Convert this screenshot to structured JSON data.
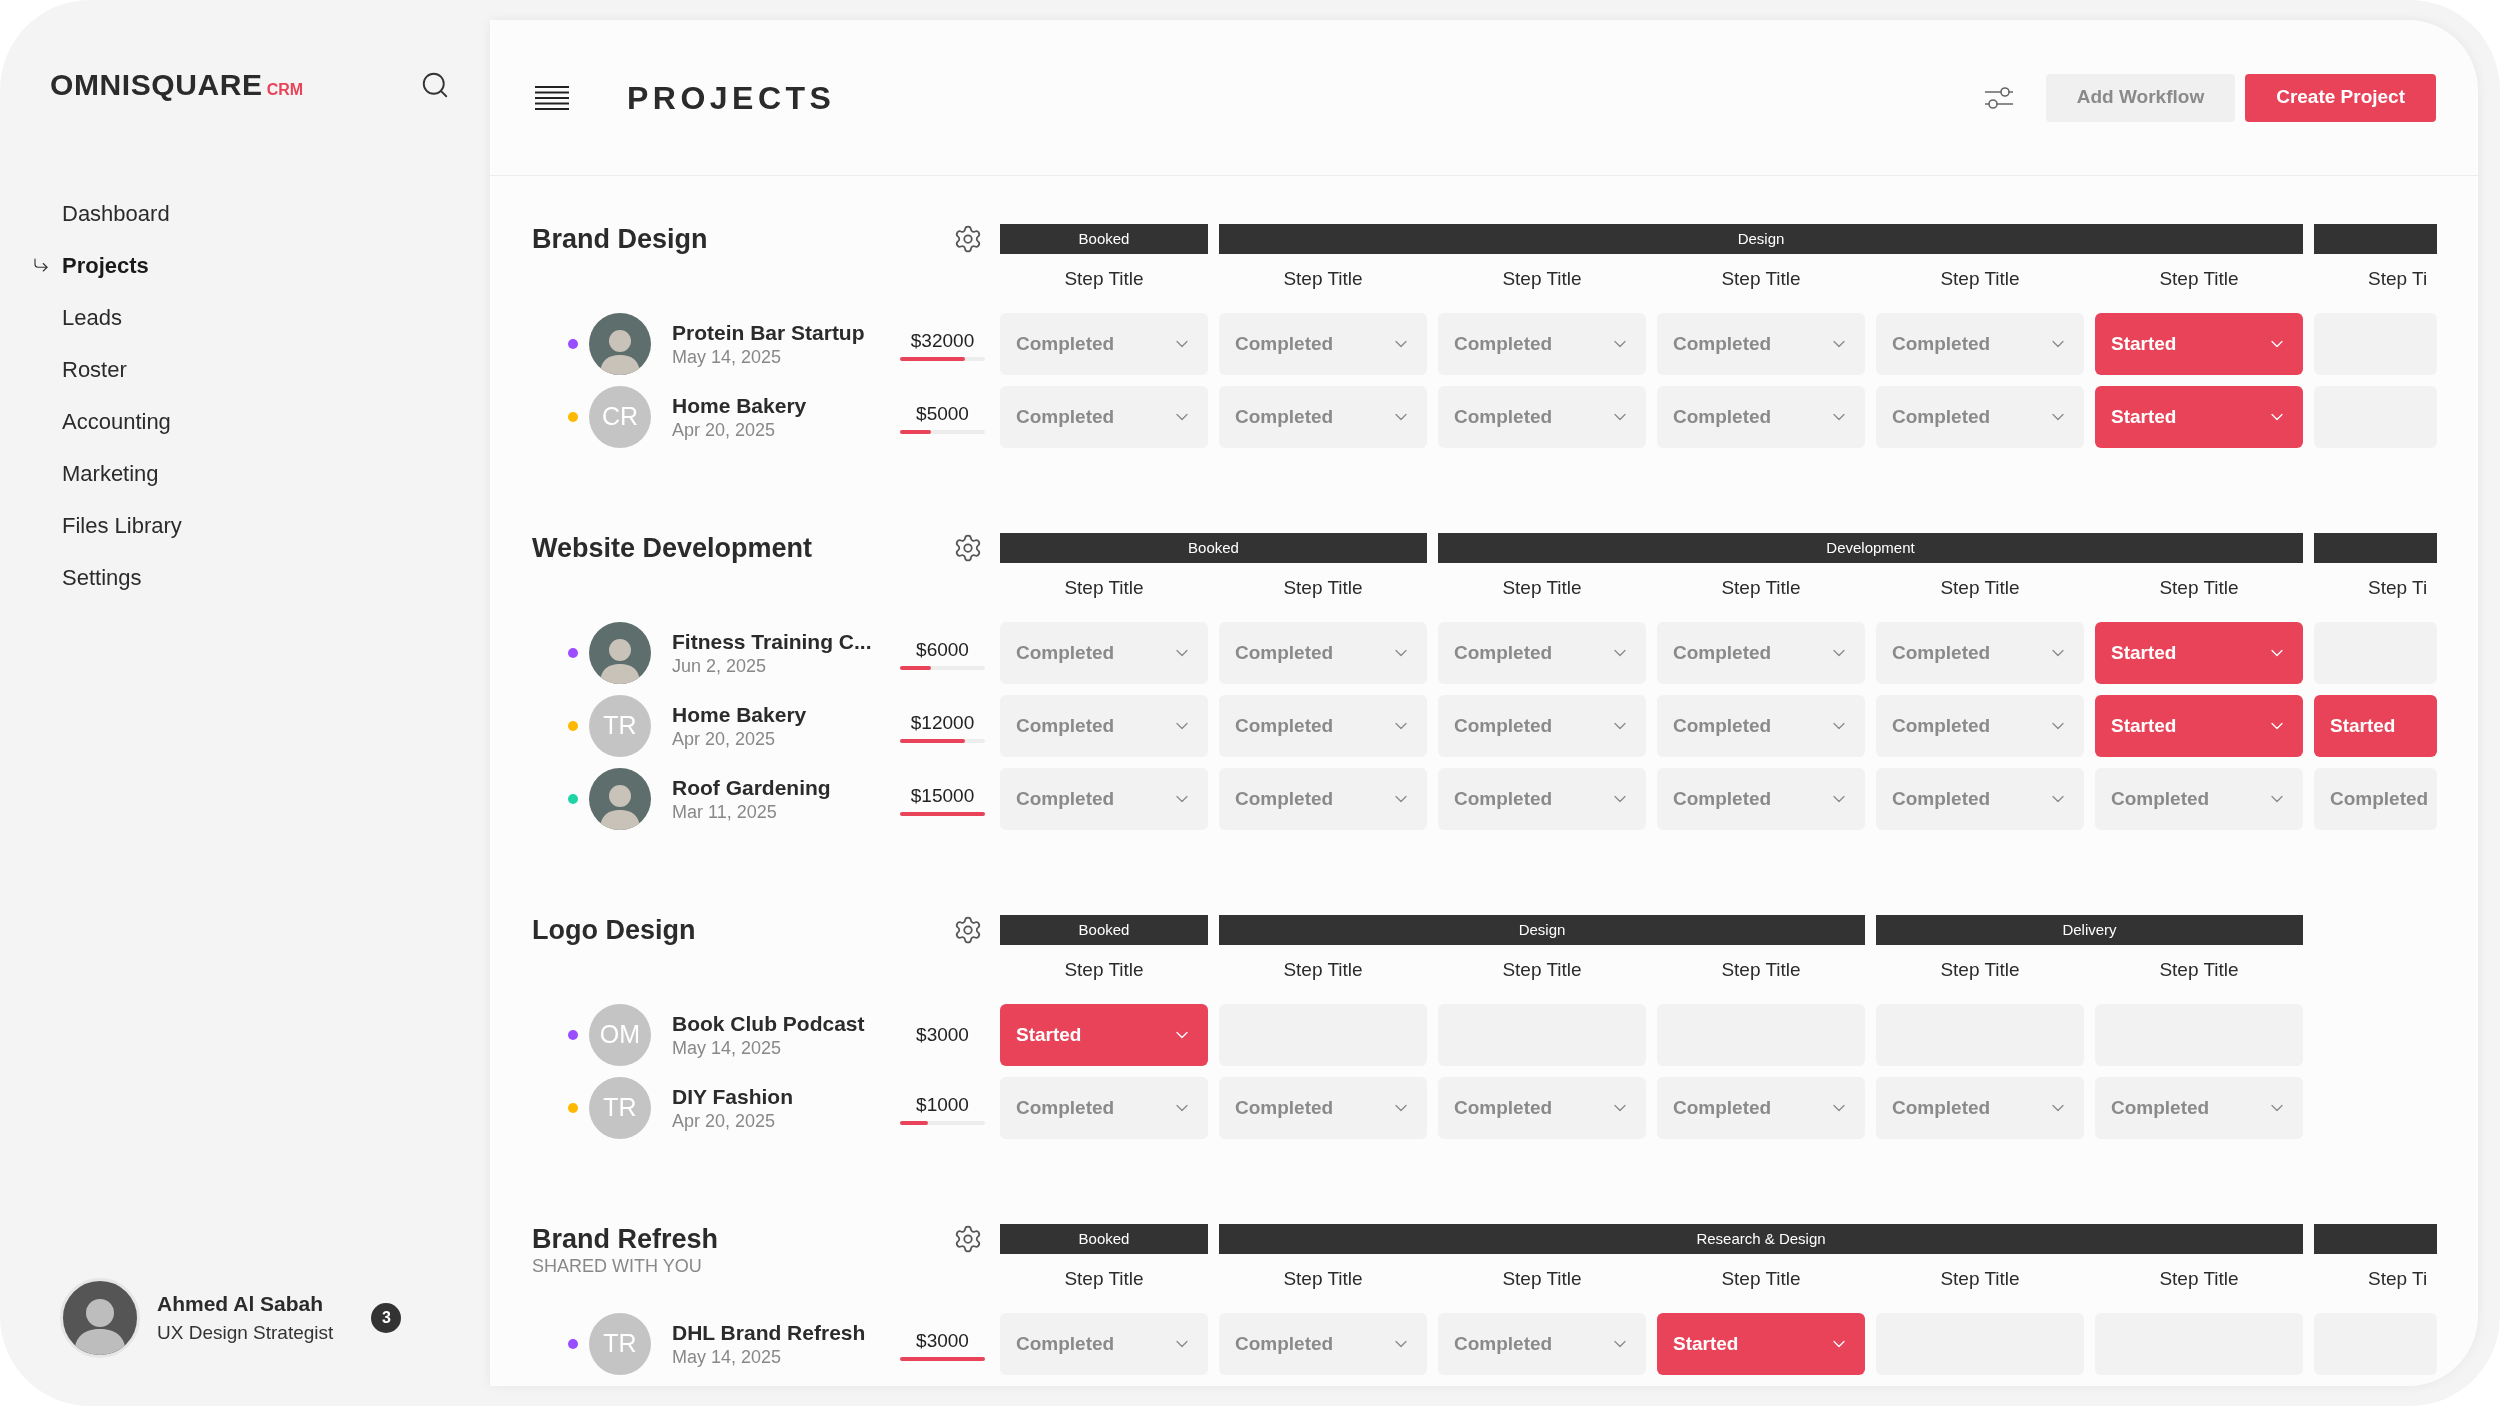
{
  "sidebar": {
    "logo": {
      "name": "OMNISQUARE",
      "suffix": "CRM"
    },
    "items": [
      {
        "label": "Dashboard",
        "selected": false
      },
      {
        "label": "Projects",
        "selected": true
      },
      {
        "label": "Leads",
        "selected": false
      },
      {
        "label": "Roster",
        "selected": false
      },
      {
        "label": "Accounting",
        "selected": false
      },
      {
        "label": "Marketing",
        "selected": false
      },
      {
        "label": "Files Library",
        "selected": false
      },
      {
        "label": "Settings",
        "selected": false
      }
    ],
    "user": {
      "name": "Ahmed Al Sabah",
      "role": "UX Design Strategist",
      "badge": "3"
    }
  },
  "header": {
    "title": "PROJECTS",
    "buttons": [
      {
        "label": "Add Workflow",
        "kind": "secondary"
      },
      {
        "label": "Create Project",
        "kind": "primary"
      }
    ]
  },
  "sections": [
    {
      "title": "Brand Design",
      "groups": [
        {
          "label": "Booked",
          "steps": [
            {
              "title": "Step Title",
              "cut": false
            }
          ]
        },
        {
          "label": "Design",
          "steps": [
            {
              "title": "Step Title",
              "cut": false
            },
            {
              "title": "Step Title",
              "cut": false
            },
            {
              "title": "Step Title",
              "cut": false
            },
            {
              "title": "Step Title",
              "cut": false
            },
            {
              "title": "Step Title",
              "cut": false
            }
          ]
        },
        {
          "steps": [
            {
              "title": "Step Ti",
              "cut": true
            }
          ]
        }
      ],
      "rows": [
        {
          "name": "Protein Bar Startup",
          "date": "May 14, 2025",
          "color": "#9b4dff",
          "avatar": {
            "kind": "photo"
          },
          "price": "$32000",
          "level": 0.77,
          "cells": [
            {
              "kind": "done",
              "label": "Completed"
            },
            {
              "kind": "done",
              "label": "Completed"
            },
            {
              "kind": "done",
              "label": "Completed"
            },
            {
              "kind": "done",
              "label": "Completed"
            },
            {
              "kind": "done",
              "label": "Completed"
            },
            {
              "kind": "active",
              "label": "Started"
            },
            {
              "kind": "empty"
            }
          ]
        },
        {
          "name": "Home Bakery",
          "date": "Apr 20, 2025",
          "color": "#ffb800",
          "avatar": {
            "kind": "initials",
            "text": "CR"
          },
          "price": "$5000",
          "level": 0.37,
          "cells": [
            {
              "kind": "done",
              "label": "Completed"
            },
            {
              "kind": "done",
              "label": "Completed"
            },
            {
              "kind": "done",
              "label": "Completed"
            },
            {
              "kind": "done",
              "label": "Completed"
            },
            {
              "kind": "done",
              "label": "Completed"
            },
            {
              "kind": "active",
              "label": "Started"
            },
            {
              "kind": "empty"
            }
          ]
        }
      ]
    },
    {
      "title": "Website Development",
      "groups": [
        {
          "label": "Booked",
          "steps": [
            {
              "title": "Step Title",
              "cut": false
            },
            {
              "title": "Step Title",
              "cut": false
            }
          ]
        },
        {
          "label": "Development",
          "steps": [
            {
              "title": "Step Title",
              "cut": false
            },
            {
              "title": "Step Title",
              "cut": false
            },
            {
              "title": "Step Title",
              "cut": false
            },
            {
              "title": "Step Title",
              "cut": false
            }
          ]
        },
        {
          "steps": [
            {
              "title": "Step Ti",
              "cut": true
            }
          ]
        }
      ],
      "rows": [
        {
          "name": "Fitness Training C...",
          "date": "Jun 2, 2025",
          "color": "#9b4dff",
          "avatar": {
            "kind": "photo"
          },
          "price": "$6000",
          "level": 0.37,
          "cells": [
            {
              "kind": "done",
              "label": "Completed"
            },
            {
              "kind": "done",
              "label": "Completed"
            },
            {
              "kind": "done",
              "label": "Completed"
            },
            {
              "kind": "done",
              "label": "Completed"
            },
            {
              "kind": "done",
              "label": "Completed"
            },
            {
              "kind": "active",
              "label": "Started"
            },
            {
              "kind": "empty"
            }
          ]
        },
        {
          "name": "Home Bakery",
          "date": "Apr 20, 2025",
          "color": "#ffb800",
          "avatar": {
            "kind": "initials",
            "text": "TR"
          },
          "price": "$12000",
          "level": 0.77,
          "cells": [
            {
              "kind": "done",
              "label": "Completed"
            },
            {
              "kind": "done",
              "label": "Completed"
            },
            {
              "kind": "done",
              "label": "Completed"
            },
            {
              "kind": "done",
              "label": "Completed"
            },
            {
              "kind": "done",
              "label": "Completed"
            },
            {
              "kind": "active",
              "label": "Started"
            },
            {
              "kind": "active",
              "label": "Started"
            }
          ]
        },
        {
          "name": "Roof Gardening",
          "date": "Mar 11, 2025",
          "color": "#1ed4a6",
          "avatar": {
            "kind": "photo"
          },
          "price": "$15000",
          "level": 1,
          "cells": [
            {
              "kind": "done",
              "label": "Completed"
            },
            {
              "kind": "done",
              "label": "Completed"
            },
            {
              "kind": "done",
              "label": "Completed"
            },
            {
              "kind": "done",
              "label": "Completed"
            },
            {
              "kind": "done",
              "label": "Completed"
            },
            {
              "kind": "done",
              "label": "Completed"
            },
            {
              "kind": "done",
              "label": "Completed"
            }
          ]
        }
      ]
    },
    {
      "title": "Logo Design",
      "groups": [
        {
          "label": "Booked",
          "steps": [
            {
              "title": "Step Title",
              "cut": false
            }
          ]
        },
        {
          "label": "Design",
          "steps": [
            {
              "title": "Step Title",
              "cut": false
            },
            {
              "title": "Step Title",
              "cut": false
            },
            {
              "title": "Step Title",
              "cut": false
            }
          ]
        },
        {
          "label": "Delivery",
          "steps": [
            {
              "title": "Step Title",
              "cut": false
            },
            {
              "title": "Step Title",
              "cut": false
            }
          ]
        }
      ],
      "rows": [
        {
          "name": "Book Club Podcast",
          "date": "May 14, 2025",
          "color": "#9b4dff",
          "avatar": {
            "kind": "initials",
            "text": "OM"
          },
          "price": "$3000",
          "cells": [
            {
              "kind": "active",
              "label": "Started"
            },
            {
              "kind": "empty"
            },
            {
              "kind": "empty"
            },
            {
              "kind": "empty"
            },
            {
              "kind": "empty"
            },
            {
              "kind": "empty"
            }
          ]
        },
        {
          "name": "DIY Fashion",
          "date": "Apr 20, 2025",
          "color": "#ffb800",
          "avatar": {
            "kind": "initials",
            "text": "TR"
          },
          "price": "$1000",
          "level": 0.33,
          "cells": [
            {
              "kind": "done",
              "label": "Completed"
            },
            {
              "kind": "done",
              "label": "Completed"
            },
            {
              "kind": "done",
              "label": "Completed"
            },
            {
              "kind": "done",
              "label": "Completed"
            },
            {
              "kind": "done",
              "label": "Completed"
            },
            {
              "kind": "done",
              "label": "Completed"
            }
          ]
        }
      ]
    },
    {
      "title": "Brand Refresh",
      "subtitle": "SHARED WITH YOU",
      "groups": [
        {
          "label": "Booked",
          "steps": [
            {
              "title": "Step Title",
              "cut": false
            }
          ]
        },
        {
          "label": "Research & Design",
          "steps": [
            {
              "title": "Step Title",
              "cut": false
            },
            {
              "title": "Step Title",
              "cut": false
            },
            {
              "title": "Step Title",
              "cut": false
            },
            {
              "title": "Step Title",
              "cut": false
            },
            {
              "title": "Step Title",
              "cut": false
            }
          ]
        },
        {
          "steps": [
            {
              "title": "Step Ti",
              "cut": true
            }
          ]
        }
      ],
      "rows": [
        {
          "name": "DHL Brand Refresh",
          "date": "May 14, 2025",
          "color": "#9b4dff",
          "avatar": {
            "kind": "initials",
            "text": "TR"
          },
          "price": "$3000",
          "level": 1,
          "cells": [
            {
              "kind": "done",
              "label": "Completed"
            },
            {
              "kind": "done",
              "label": "Completed"
            },
            {
              "kind": "done",
              "label": "Completed"
            },
            {
              "kind": "active",
              "label": "Started"
            },
            {
              "kind": "empty"
            },
            {
              "kind": "empty"
            },
            {
              "kind": "empty"
            }
          ]
        }
      ]
    }
  ]
}
